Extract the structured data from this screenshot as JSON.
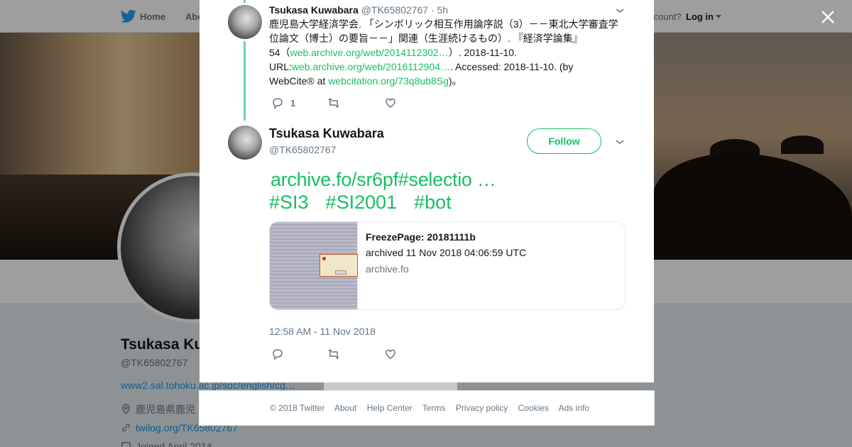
{
  "topnav": {
    "home": "Home",
    "about": "Abo",
    "account": "ccount?",
    "login": "Log in"
  },
  "profile": {
    "name": "Tsukasa Ku",
    "handle": "@TK65802767",
    "website": "www2.sal.tohoku.ac.jp/soc/english/cg…",
    "location": "鹿児島県鹿児",
    "twilog": "twilog.org/TK65802767",
    "joined": "Joined April 2014"
  },
  "modal": {
    "tweet1": {
      "name": "Tsukasa Kuwabara",
      "handle": "@TK65802767",
      "time": "· 5h",
      "body": {
        "line1": "鹿児島大学経済学会. 「シンボリック相互作用論序説（3）－－東北大学審査学位論文（博士）の要旨－－」関連（生涯続けるもの）. 『経済学論集』",
        "line3_pre": "54（",
        "line3_link": "web.archive.org/web/2014112302…",
        "line3_post": "）. 2018-11-10.",
        "line4_pre": "URL:",
        "line4_link": "web.archive.org/web/2016112904…",
        "line4_post": ". Accessed: 2018-11-10. (by",
        "line5_pre": "WebCite® at ",
        "line5_link": "webcitation.org/73q8ub8Sg",
        "line5_post": ")。"
      },
      "reply_count": "1"
    },
    "tweet2": {
      "name": "Tsukasa Kuwabara",
      "handle": "@TK65802767",
      "follow_label": "Follow",
      "link_text": "archive.fo/sr6pf#selectio …",
      "hashtags": [
        "#SI3",
        "#SI2001",
        "#bot"
      ],
      "card": {
        "title": "FreezePage: 20181111b",
        "description": "archived 11 Nov 2018 04:06:59 UTC",
        "domain": "archive.fo"
      },
      "timestamp": "12:58 AM - 11 Nov 2018"
    }
  },
  "footer": {
    "items": [
      "© 2018 Twitter",
      "About",
      "Help Center",
      "Terms",
      "Privacy policy",
      "Cookies",
      "Ads info"
    ]
  },
  "colors": {
    "accent": "#17bf63",
    "muted": "#657786",
    "brand": "#1da1f2"
  }
}
